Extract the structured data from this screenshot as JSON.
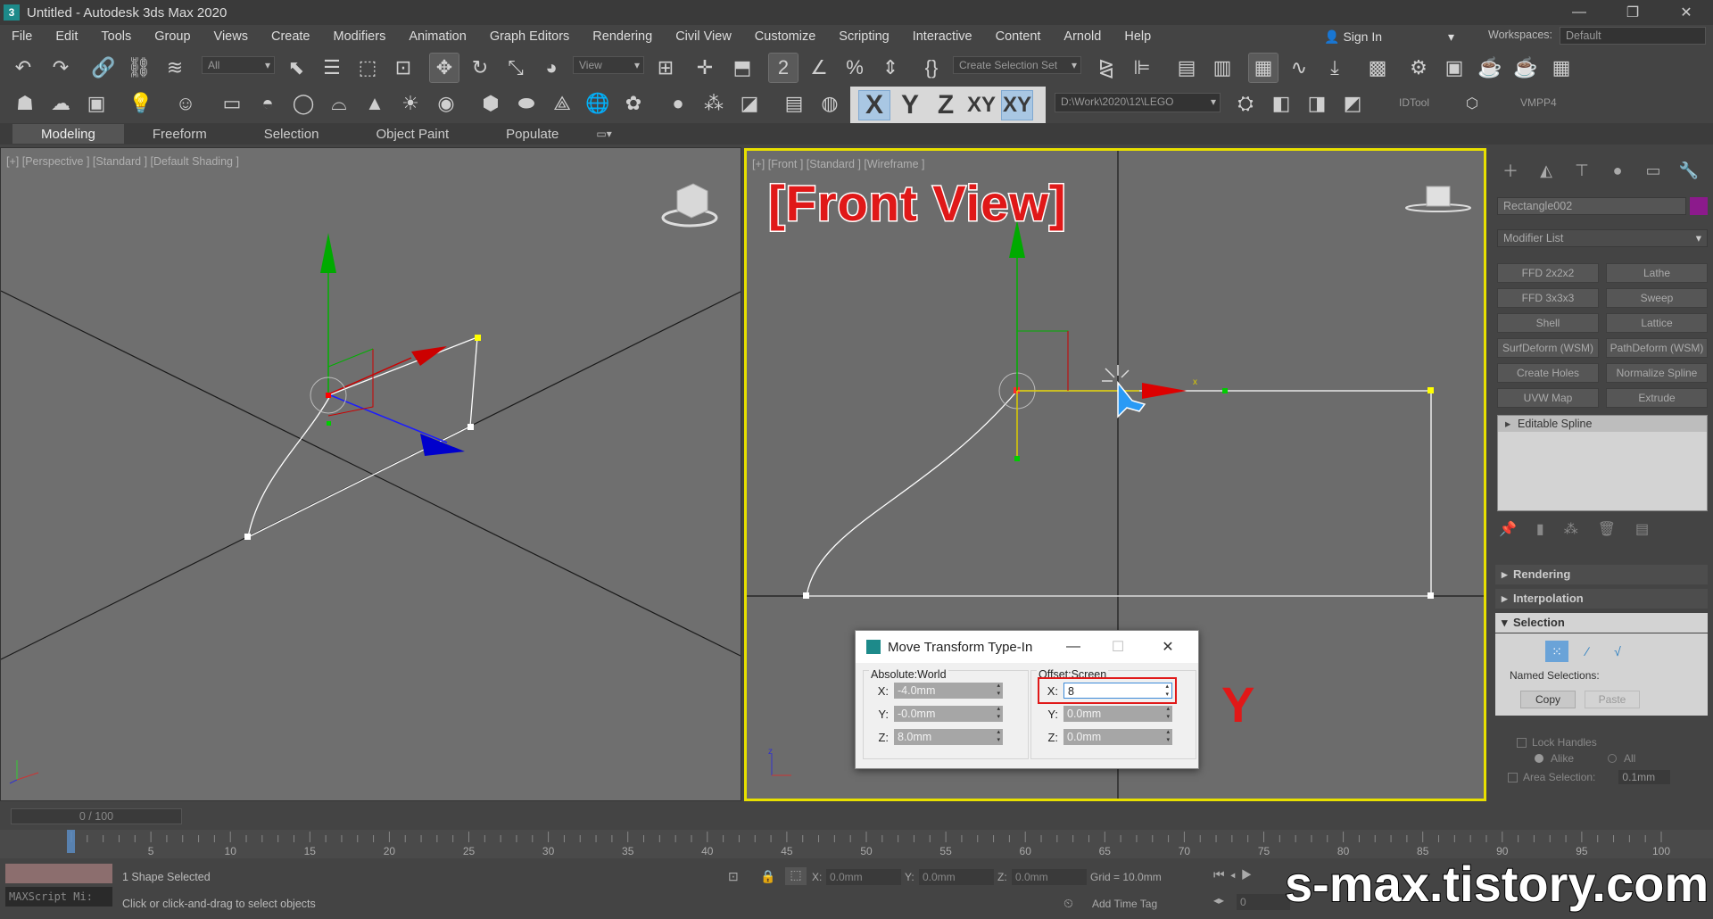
{
  "window": {
    "title": "Untitled - Autodesk 3ds Max 2020",
    "app_icon": "3ds-max-icon"
  },
  "menu": {
    "items": [
      "File",
      "Edit",
      "Tools",
      "Group",
      "Views",
      "Create",
      "Modifiers",
      "Animation",
      "Graph Editors",
      "Rendering",
      "Civil View",
      "Customize",
      "Scripting",
      "Interactive",
      "Content",
      "Arnold",
      "Help"
    ],
    "sign_in": "Sign In",
    "workspaces_label": "Workspaces:",
    "workspaces_value": "Default"
  },
  "toolbar": {
    "filter": "All",
    "ref_coord": "View",
    "selection_set": "Create Selection Set",
    "path": "D:\\Work\\2020\\12\\LEGO",
    "idtool": "IDTool",
    "vmpp4": "VMPP4",
    "axis": {
      "x": "X",
      "y": "Y",
      "z": "Z",
      "xy": "XY",
      "xy2": "XY",
      "active": "X"
    }
  },
  "ribbon": {
    "tabs": [
      "Modeling",
      "Freeform",
      "Selection",
      "Object Paint",
      "Populate"
    ],
    "active": "Modeling"
  },
  "viewports": {
    "perspective": {
      "label": "[+] [Perspective ] [Standard ] [Default Shading ]"
    },
    "front": {
      "label": "[+] [Front ] [Standard ] [Wireframe ]",
      "caption": "[Front View]",
      "annotation": "Y"
    }
  },
  "command_panel": {
    "object_name": "Rectangle002",
    "object_color": "#8c1a8c",
    "modifier_list": "Modifier List",
    "modifier_buttons": [
      "FFD 2x2x2",
      "Lathe",
      "FFD 3x3x3",
      "Sweep",
      "Shell",
      "Lattice",
      "SurfDeform (WSM)",
      "PathDeform (WSM)",
      "Create Holes",
      "Normalize Spline",
      "UVW Map",
      "Extrude"
    ],
    "stack_item": "Editable Spline",
    "rollouts": [
      "Rendering",
      "Interpolation",
      "Selection"
    ],
    "named_selections": "Named Selections:",
    "copy": "Copy",
    "paste": "Paste",
    "lock_handles": "Lock Handles",
    "alike": "Alike",
    "all": "All",
    "area_selection": "Area Selection:",
    "area_value": "0.1mm"
  },
  "dialog": {
    "title": "Move Transform Type-In",
    "absolute_label": "Absolute:World",
    "offset_label": "Offset:Screen",
    "absolute": {
      "x": "-4.0mm",
      "y": "-0.0mm",
      "z": "8.0mm"
    },
    "offset": {
      "x": "8",
      "y": "0.0mm",
      "z": "0.0mm"
    },
    "labels": {
      "x": "X:",
      "y": "Y:",
      "z": "Z:"
    }
  },
  "timeline": {
    "slider": "0 / 100",
    "ticks": [
      "5",
      "10",
      "15",
      "20",
      "25",
      "30",
      "35",
      "40",
      "45",
      "50",
      "55",
      "60",
      "65",
      "70",
      "75",
      "80",
      "85",
      "90",
      "95",
      "100"
    ]
  },
  "status": {
    "selected": "1 Shape Selected",
    "prompt": "Click or click-and-drag to select objects",
    "maxscript": "MAXScript Mi:",
    "x_label": "X:",
    "x_value": "0.0mm",
    "y_label": "Y:",
    "y_value": "0.0mm",
    "z_label": "Z:",
    "z_value": "0.0mm",
    "grid": "Grid = 10.0mm",
    "add_time_tag": "Add Time Tag",
    "frame": "0"
  },
  "watermark": "s-max.tistory.com"
}
